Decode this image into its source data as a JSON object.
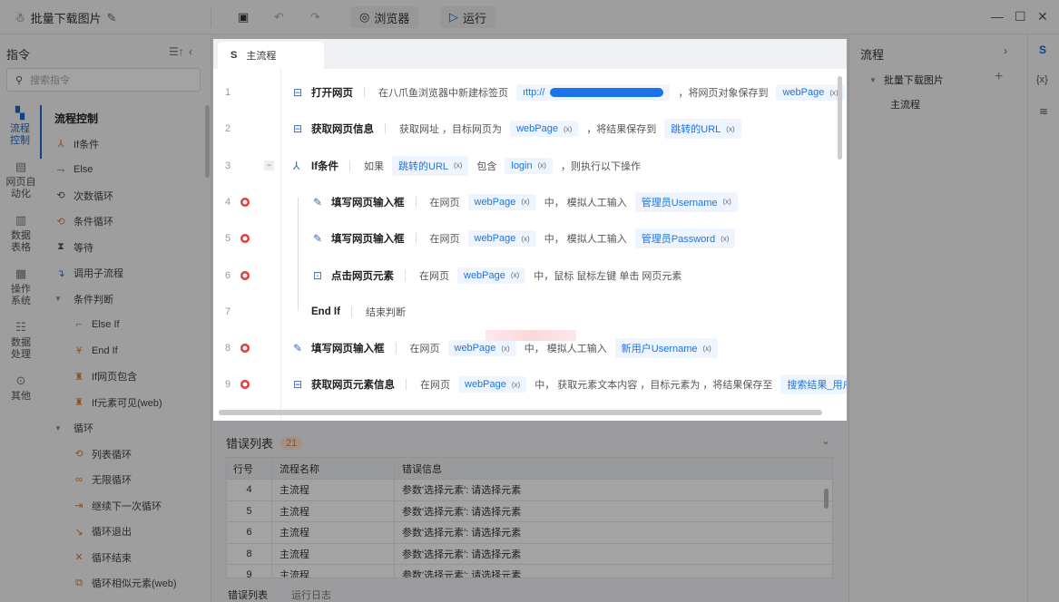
{
  "app": {
    "title": "批量下载图片",
    "browser_label": "浏览器",
    "run_label": "运行"
  },
  "left": {
    "title": "指令",
    "search_placeholder": "搜索指令",
    "categories": [
      "流程控制",
      "网页自动化",
      "数据表格",
      "操作系统",
      "数据处理",
      "其他"
    ],
    "group": "流程控制",
    "items": [
      "If条件",
      "Else",
      "次数循环",
      "条件循环",
      "等待",
      "调用子流程"
    ],
    "sub_group1": "条件判断",
    "sub_items1": [
      "Else If",
      "End If",
      "If网页包含",
      "If元素可见(web)"
    ],
    "sub_group2": "循环",
    "sub_items2": [
      "列表循环",
      "无限循环",
      "继续下一次循环",
      "循环退出",
      "循环结束",
      "循环相似元素(web)"
    ]
  },
  "editor": {
    "tab": "主流程",
    "rows": [
      {
        "n": "1",
        "name": "打开网页",
        "parts": [
          [
            "t",
            "在八爪鱼浏览器中新建标签页"
          ],
          [
            "url",
            "ıttp://"
          ],
          [
            "t",
            "，将网页对象保存到"
          ],
          [
            "v",
            "webPage"
          ]
        ]
      },
      {
        "n": "2",
        "name": "获取网页信息",
        "parts": [
          [
            "t",
            "获取网址 ，目标网页为"
          ],
          [
            "v",
            "webPage"
          ],
          [
            "t",
            "，将结果保存到"
          ],
          [
            "v",
            "跳转的URL"
          ]
        ]
      },
      {
        "n": "3",
        "name": "If条件",
        "parts": [
          [
            "t",
            "如果"
          ],
          [
            "v",
            "跳转的URL"
          ],
          [
            "t",
            "包含"
          ],
          [
            "v",
            "login"
          ],
          [
            "t",
            "，则执行以下操作"
          ]
        ]
      },
      {
        "n": "4",
        "name": "填写网页输入框",
        "parts": [
          [
            "t",
            "在网页"
          ],
          [
            "v",
            "webPage"
          ],
          [
            "t",
            "中，  模拟人工输入"
          ],
          [
            "v",
            "管理员Username"
          ]
        ]
      },
      {
        "n": "5",
        "name": "填写网页输入框",
        "parts": [
          [
            "t",
            "在网页"
          ],
          [
            "v",
            "webPage"
          ],
          [
            "t",
            "中，  模拟人工输入"
          ],
          [
            "v",
            "管理员Password"
          ]
        ]
      },
      {
        "n": "6",
        "name": "点击网页元素",
        "parts": [
          [
            "t",
            "在网页"
          ],
          [
            "v",
            "webPage"
          ],
          [
            "t",
            "中，鼠标  鼠标左键  单击  网页元素"
          ]
        ]
      },
      {
        "n": "7",
        "name": "End If",
        "parts": [
          [
            "t",
            "结束判断"
          ]
        ]
      },
      {
        "n": "8",
        "name": "填写网页输入框",
        "parts": [
          [
            "t",
            "在网页"
          ],
          [
            "v",
            "webPage"
          ],
          [
            "t",
            "中，  模拟人工输入"
          ],
          [
            "v",
            "新用户Username"
          ]
        ]
      },
      {
        "n": "9",
        "name": "获取网页元素信息",
        "parts": [
          [
            "t",
            "在网页"
          ],
          [
            "v",
            "webPage"
          ],
          [
            "t",
            "中，  获取元素文本内容 ，目标元素为 ，将结果保存至"
          ],
          [
            "v",
            "搜索结果_用户名"
          ]
        ]
      }
    ]
  },
  "errors": {
    "title": "错误列表",
    "count": "21",
    "headers": [
      "行号",
      "流程名称",
      "错误信息"
    ],
    "rows": [
      [
        "4",
        "主流程",
        "参数'选择元素': 请选择元素"
      ],
      [
        "5",
        "主流程",
        "参数'选择元素': 请选择元素"
      ],
      [
        "6",
        "主流程",
        "参数'选择元素': 请选择元素"
      ],
      [
        "8",
        "主流程",
        "参数'选择元素': 请选择元素"
      ],
      [
        "9",
        "主流程",
        "参数'选择元素': 请选择元素"
      ]
    ],
    "tabs": [
      "错误列表",
      "运行日志"
    ]
  },
  "right": {
    "title": "流程",
    "project": "批量下载图片",
    "flow": "主流程"
  },
  "colors": {
    "accent": "#1a73e8",
    "error": "#e53b3b",
    "orange": "#e07a2e"
  }
}
